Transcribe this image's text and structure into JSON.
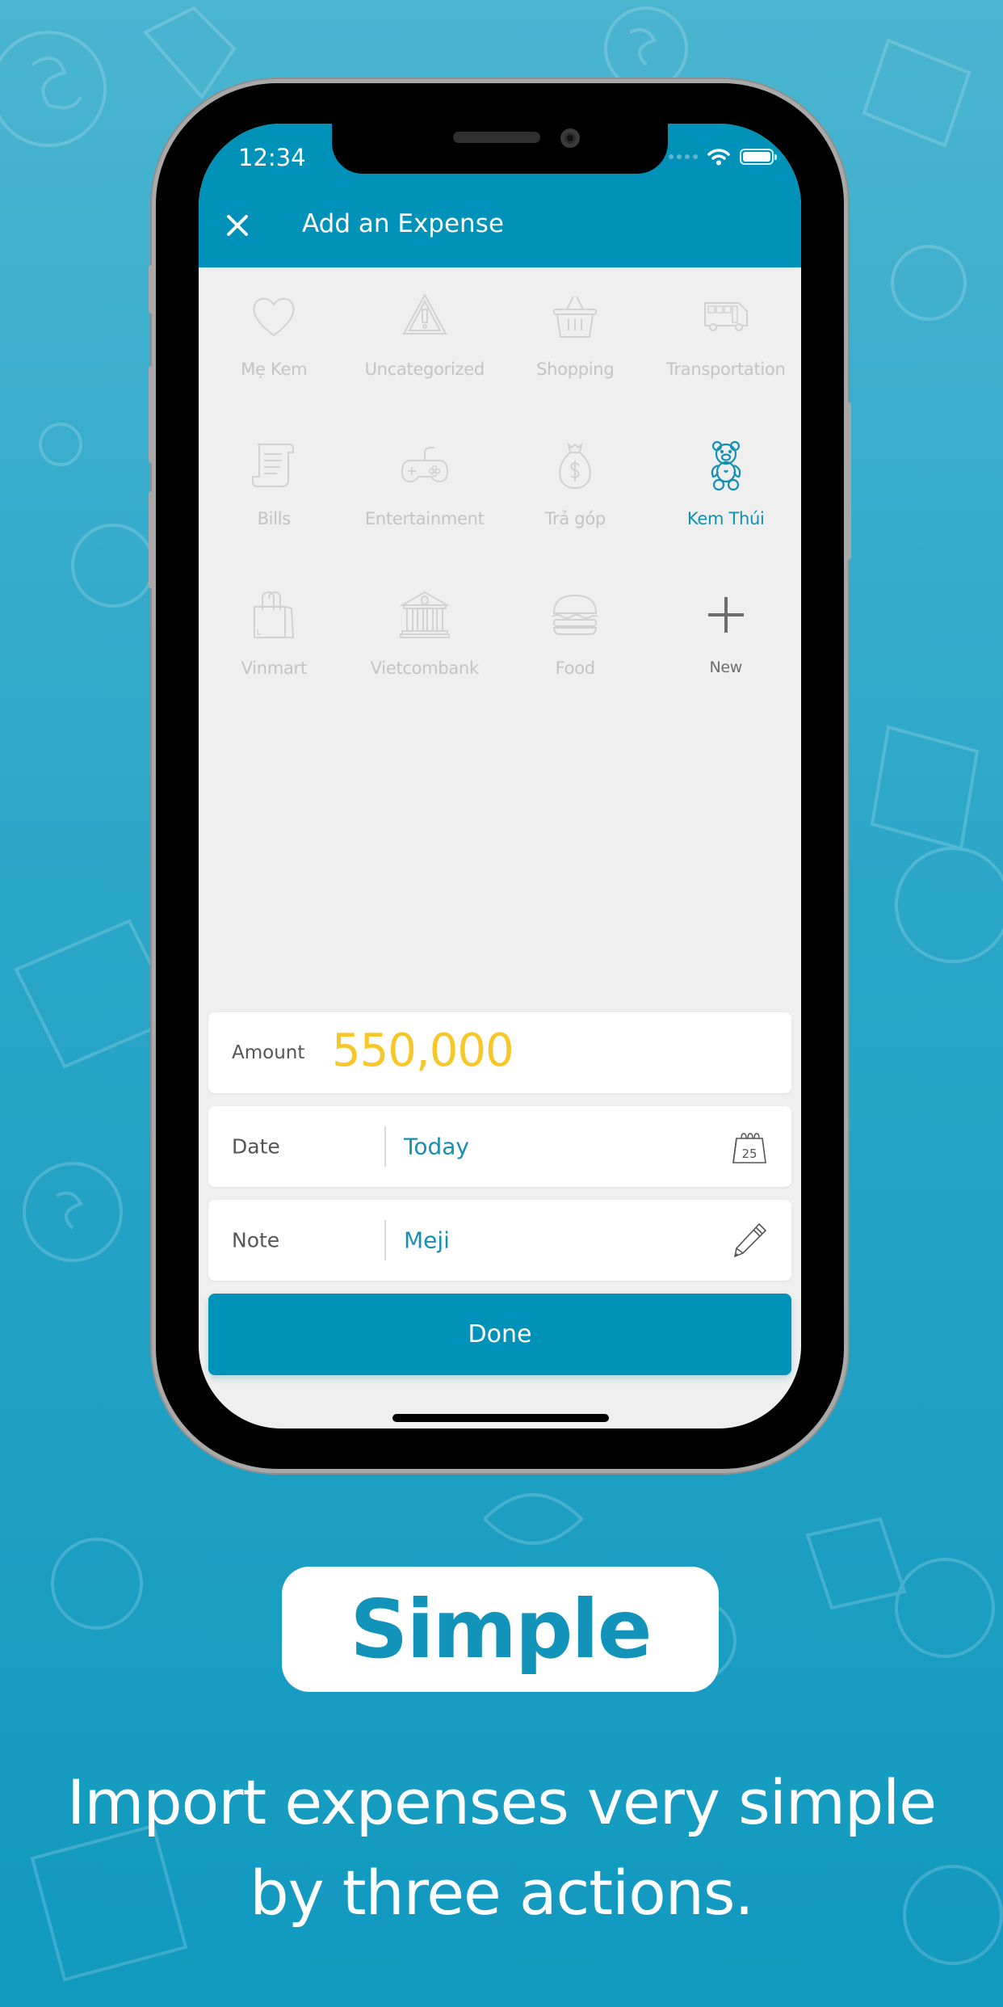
{
  "status_bar": {
    "time": "12:34",
    "signal_icon": "signal-dots-icon",
    "wifi_icon": "wifi-icon",
    "battery_icon": "battery-icon"
  },
  "header": {
    "close_icon": "close-icon",
    "title": "Add an Expense"
  },
  "categories": [
    {
      "label": "Mẹ Kem",
      "icon": "heart-icon",
      "selected": false
    },
    {
      "label": "Uncategorized",
      "icon": "warning-triangle-icon",
      "selected": false
    },
    {
      "label": "Shopping",
      "icon": "basket-icon",
      "selected": false
    },
    {
      "label": "Transportation",
      "icon": "bus-icon",
      "selected": false
    },
    {
      "label": "Bills",
      "icon": "receipt-scroll-icon",
      "selected": false
    },
    {
      "label": "Entertainment",
      "icon": "gamepad-icon",
      "selected": false
    },
    {
      "label": "Trả góp",
      "icon": "money-bag-icon",
      "selected": false
    },
    {
      "label": "Kem Thúi",
      "icon": "teddy-bear-icon",
      "selected": true
    },
    {
      "label": "Vinmart",
      "icon": "shopping-bag-icon",
      "selected": false
    },
    {
      "label": "Vietcombank",
      "icon": "bank-icon",
      "selected": false
    },
    {
      "label": "Food",
      "icon": "burger-icon",
      "selected": false
    },
    {
      "label": "New",
      "icon": "plus-icon",
      "selected": false
    }
  ],
  "form": {
    "amount_label": "Amount",
    "amount_value": "550,000",
    "date_label": "Date",
    "date_value": "Today",
    "date_icon": "calendar-icon",
    "calendar_day": "25",
    "note_label": "Note",
    "note_value": "Meji",
    "note_icon": "pencil-icon",
    "done_label": "Done"
  },
  "marketing": {
    "badge": "Simple",
    "tagline_line1": "Import expenses very simple",
    "tagline_line2": "by three actions."
  },
  "colors": {
    "primary": "#0092b8",
    "amount": "#f7c72a",
    "selected": "#138fb0",
    "inactive": "#c4c4c4",
    "background": "#2aa6c8"
  }
}
